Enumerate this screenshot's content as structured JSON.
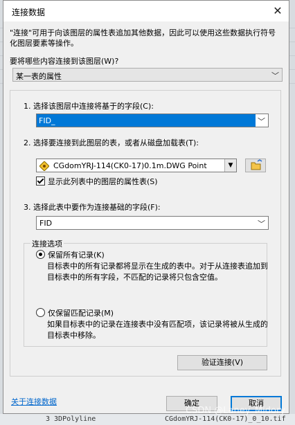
{
  "window": {
    "title": "连接数据"
  },
  "intro": "\"连接\"可用于向该图层的属性表追加其他数据，因此可以使用这些数据执行符号化图层要素等操作。",
  "question": "要将哪些内容连接到该图层(W)?",
  "join_type": {
    "selected": "某一表的属性"
  },
  "step1": {
    "label": "1. 选择该图层中连接将基于的字段(C):",
    "value": "FID_"
  },
  "step2": {
    "label": "2. 选择要连接到此图层的表，或者从磁盘加载表(T):",
    "table": "CGdomYRJ-114(CK0-17)0.1m.DWG Point",
    "checkbox": "显示此列表中的图层的属性表(S)"
  },
  "step3": {
    "label": "3. 选择此表中要作为连接基础的字段(F):",
    "value": "FID"
  },
  "options": {
    "title": "连接选项",
    "keep_all": {
      "label": "保留所有记录(K)",
      "desc": "目标表中的所有记录都将显示在生成的表中。对于从连接表追加到目标表中的所有字段，不匹配的记录将只包含空值。"
    },
    "keep_matching": {
      "label": "仅保留匹配记录(M)",
      "desc": "如果目标表中的记录在连接表中没有匹配项，该记录将被从生成的目标表中移除。"
    }
  },
  "validate_button": "验证连接(V)",
  "about_link": "关于连接数据",
  "ok_button": "确定",
  "cancel_button": "取消",
  "background": {
    "left_row": "3 3DPolyline",
    "right_row": "CGdomYRJ-114(CK0-17)_0_10.tif",
    "watermark": "CSDN @Laney_Midory"
  }
}
